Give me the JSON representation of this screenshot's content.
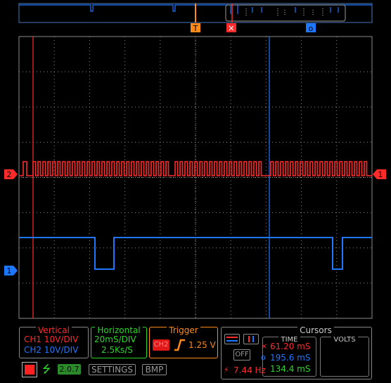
{
  "colors": {
    "ch1": "#ff2a2a",
    "ch2": "#1e78ff",
    "grid": "#a0a0a0",
    "text": "#c8c8c8",
    "horizontal": "#2bd62b",
    "trigger": "#ff8a1a",
    "cursors": "#d0d0d0",
    "background": "#000000"
  },
  "markers": {
    "trigger": "T",
    "cursor_x": "×",
    "cursor_o": "o",
    "ch2_left": "2",
    "ch1_left": "1",
    "ch1_right": "1"
  },
  "vertical": {
    "title": "Vertical",
    "ch1": "CH1 10V/DIV",
    "ch2": "CH2 10V/DIV"
  },
  "horizontal": {
    "title": "Horizontal",
    "timebase": "20mS/DIV",
    "sample_rate": "2.5Ks/S"
  },
  "trigger": {
    "title": "Trigger",
    "source": "CH2",
    "slope_icon": "rising-edge-icon",
    "level": "1.25 V"
  },
  "cursors": {
    "title": "Cursors",
    "time_title": "TIME",
    "volts_title": "VOLTS",
    "off_label": "OFF",
    "x_time": "61.20 mS",
    "o_time": "195.6 mS",
    "delta_time": "134.4 mS",
    "freq": "7.44 Hz"
  },
  "toolbar": {
    "version": "2.0.7",
    "settings_label": "SETTINGS",
    "bmp_label": "BMP",
    "usb_icon": "usb-icon",
    "stop_icon": "stop-icon"
  }
}
